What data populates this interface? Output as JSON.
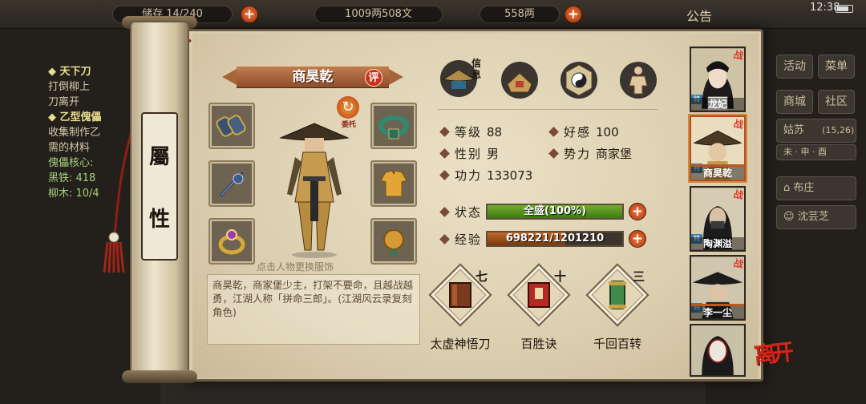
{
  "hud": {
    "capacity": "储存 14/240",
    "money": "1009两508文",
    "ingots": "558两",
    "announcement": "公告",
    "time": "12:38"
  },
  "left_quest": {
    "lines": [
      "◆ 天下刀",
      "打倒柳上",
      "刀离开",
      "◆ 乙型傀儡",
      "收集制作乙",
      "需的材料",
      "傀儡核心:",
      "黑铁: 418",
      "柳木: 10/4"
    ]
  },
  "right_menu": {
    "btn1": "活动",
    "btn2": "菜单",
    "btn3": "商城",
    "btn4": "社区",
    "location": "姑苏",
    "coords": "(15,26)",
    "row": "未 · 申 · 酉",
    "shop1": "布庄",
    "shop2": "沈芸芝"
  },
  "scroll": {
    "rod_label_top": "屬",
    "rod_label_bottom": "性"
  },
  "character": {
    "name": "商昊乾",
    "rate_badge": "评",
    "entrust": "委托",
    "change_hint": "点击人物更换服饰",
    "bio": "商昊乾，商家堡少主，打架不要命，且越战越勇，江湖人称「拼命三郎」。(江湖风云录复刻角色)"
  },
  "tabs": {
    "info_label": "信息",
    "items": [
      "info-hat-icon",
      "backpack-icon",
      "taiji-icon",
      "martial-body-icon"
    ]
  },
  "stats": {
    "level_label": "等级",
    "level": "88",
    "favor_label": "好感",
    "favor": "100",
    "gender_label": "性别",
    "gender": "男",
    "faction_label": "势力",
    "faction": "商家堡",
    "power_label": "功力",
    "power": "133073",
    "state_label": "状态",
    "state_text": "全盛(100%)",
    "state_ratio": 1.0,
    "exp_label": "经验",
    "exp_text": "698221/1201210",
    "exp_ratio": 0.58
  },
  "skills": [
    {
      "name": "太虚神悟刀",
      "level": "七"
    },
    {
      "name": "百胜诀",
      "level": "十"
    },
    {
      "name": "千回百转",
      "level": "三"
    }
  ],
  "roster": [
    {
      "name": "龙妃",
      "tag": "特"
    },
    {
      "name": "商昊乾",
      "tag": "特"
    },
    {
      "name": "陶渊溢",
      "tag": "特"
    },
    {
      "name": "李一尘",
      "tag": "特"
    },
    {
      "name": "",
      "tag": ""
    }
  ],
  "roster_badge": "战",
  "leave_button": "离开",
  "colors": {
    "state_bar": "#6fae2e",
    "exp_bar": "#c2692b",
    "banner": "#a9603a",
    "accent_red": "#d2261c"
  }
}
